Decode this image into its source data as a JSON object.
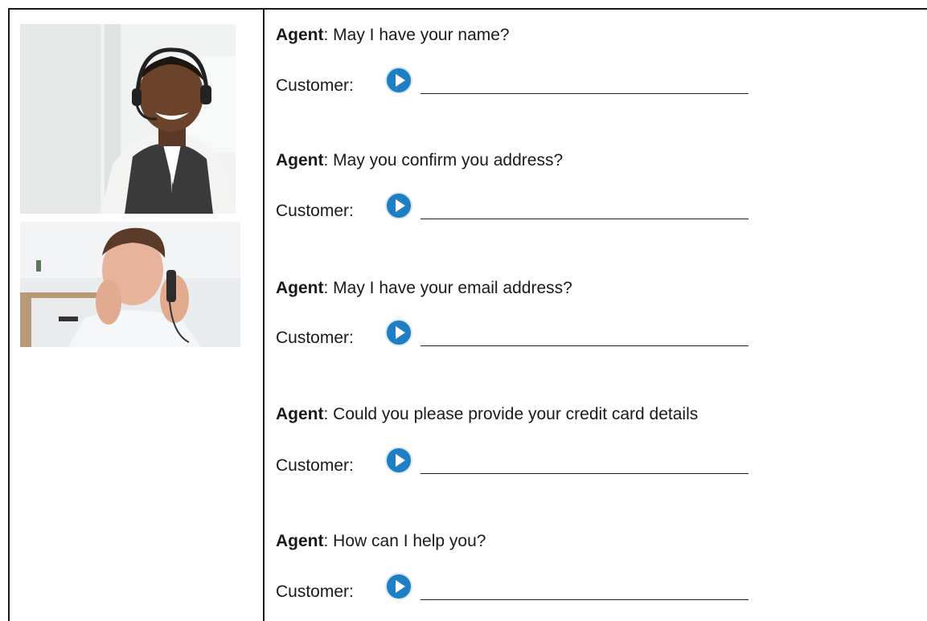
{
  "photos": {
    "agent_photo": "call-center-agent-with-headset",
    "customer_photo": "customer-on-phone"
  },
  "colors": {
    "play_button": "#1f7fc4",
    "border": "#1a1a1a"
  },
  "dialog": [
    {
      "agent_label": "Agent",
      "agent_text": ": May I have your name?",
      "customer_label": "Customer:"
    },
    {
      "agent_label": "Agent",
      "agent_text": ": May you confirm you address?",
      "customer_label": "Customer:"
    },
    {
      "agent_label": "Agent",
      "agent_text": ": May I have your  email address?",
      "customer_label": "Customer:"
    },
    {
      "agent_label": "Agent",
      "agent_text": ": Could you please provide your credit card details",
      "customer_label": "Customer:"
    },
    {
      "agent_label": "Agent",
      "agent_text": ": How can I help you?",
      "customer_label": "Customer:"
    }
  ]
}
